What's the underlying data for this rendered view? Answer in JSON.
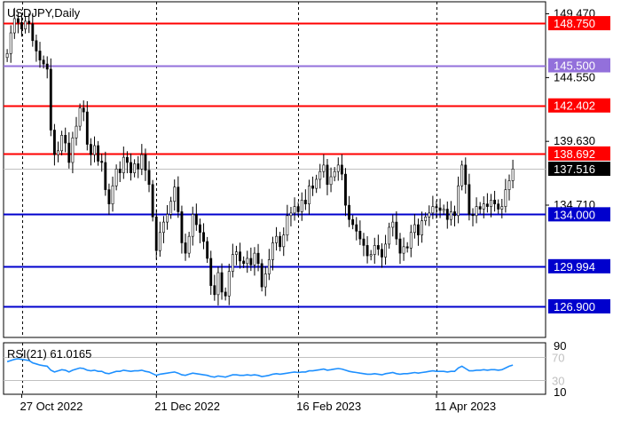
{
  "chart_data": {
    "type": "candlestick",
    "title": "USDJPY,Daily",
    "y_range": [
      124.5,
      150.4
    ],
    "x_index_range": [
      -1,
      148
    ],
    "price_ticks": [
      "149.470",
      "144.550",
      "139.630",
      "134.710"
    ],
    "x_ticks": [
      {
        "label": "27 Oct 2022",
        "index": 4
      },
      {
        "label": "21 Dec 2022",
        "index": 41
      },
      {
        "label": "16 Feb 2023",
        "index": 80
      },
      {
        "label": "11 Apr 2023",
        "index": 118
      }
    ],
    "vertical_grid_index": [
      4,
      41,
      80,
      118
    ],
    "levels": [
      {
        "price": 148.75,
        "label": "148.750",
        "color": "#ff0000",
        "bg": "#ff0000"
      },
      {
        "price": 145.5,
        "label": "145.500",
        "color": "#9370db",
        "bg": "#9370db"
      },
      {
        "price": 142.402,
        "label": "142.402",
        "color": "#ff0000",
        "bg": "#ff0000"
      },
      {
        "price": 138.692,
        "label": "138.692",
        "color": "#ff0000",
        "bg": "#ff0000"
      },
      {
        "price": 134.0,
        "label": "134.000",
        "color": "#0000cd",
        "bg": "#0000cd"
      },
      {
        "price": 129.994,
        "label": "129.994",
        "color": "#0000cd",
        "bg": "#0000cd"
      },
      {
        "price": 126.9,
        "label": "126.900",
        "color": "#0000cd",
        "bg": "#0000cd"
      }
    ],
    "current_price": {
      "price": 137.516,
      "label": "137.516"
    },
    "closes": [
      146.4,
      148.0,
      149.1,
      148.8,
      148.3,
      148.9,
      148.7,
      147.4,
      146.6,
      145.9,
      145.6,
      145.2,
      140.5,
      138.6,
      138.9,
      140.1,
      139.5,
      138.0,
      139.9,
      140.8,
      142.2,
      141.9,
      139.4,
      138.6,
      139.3,
      138.1,
      138.0,
      135.9,
      134.8,
      136.2,
      137.5,
      137.2,
      138.4,
      138.0,
      137.2,
      137.9,
      137.5,
      138.6,
      137.4,
      136.3,
      133.8,
      131.2,
      132.6,
      133.4,
      134.0,
      135.0,
      136.1,
      134.2,
      131.8,
      131.0,
      132.3,
      134.0,
      133.2,
      132.6,
      131.9,
      130.6,
      128.5,
      127.8,
      129.5,
      128.0,
      127.7,
      129.6,
      130.9,
      131.1,
      130.4,
      130.2,
      130.6,
      130.1,
      131.0,
      130.2,
      128.4,
      129.4,
      130.5,
      131.8,
      132.3,
      131.5,
      132.4,
      133.9,
      134.1,
      134.6,
      134.2,
      135.1,
      134.8,
      136.2,
      136.0,
      136.7,
      137.3,
      137.8,
      136.3,
      136.9,
      137.3,
      137.8,
      137.1,
      134.7,
      133.6,
      133.2,
      132.7,
      132.1,
      131.6,
      130.8,
      130.9,
      131.6,
      131.3,
      130.7,
      131.7,
      133.0,
      133.4,
      132.1,
      131.0,
      131.5,
      131.4,
      132.6,
      133.2,
      132.4,
      133.5,
      133.8,
      134.1,
      134.6,
      134.5,
      134.3,
      134.4,
      133.6,
      134.2,
      133.9,
      136.2,
      137.8,
      136.3,
      134.0,
      133.9,
      134.6,
      134.4,
      134.8,
      134.6,
      135.1,
      134.8,
      134.4,
      134.6,
      135.9,
      136.6,
      137.5
    ],
    "rsi": {
      "label": "RSI(21) 61.0165",
      "levels": [
        {
          "value": 70,
          "label": "70"
        },
        {
          "value": 30,
          "label": "30"
        }
      ],
      "axis_labels": [
        {
          "value": 90,
          "label": "90"
        },
        {
          "value": 10,
          "label": "10"
        }
      ],
      "range": [
        5,
        95
      ],
      "color": "#1e90ff",
      "values": [
        62,
        64,
        66,
        67,
        66,
        65,
        64,
        60,
        58,
        56,
        55,
        54,
        47,
        44,
        46,
        48,
        47,
        44,
        47,
        49,
        51,
        50,
        47,
        46,
        47,
        45,
        45,
        42,
        41,
        43,
        45,
        45,
        47,
        46,
        45,
        46,
        46,
        47,
        45,
        44,
        41,
        38,
        40,
        41,
        42,
        43,
        44,
        42,
        39,
        38,
        40,
        42,
        41,
        40,
        39,
        38,
        36,
        35,
        37,
        36,
        35,
        37,
        39,
        39,
        38,
        38,
        39,
        38,
        39,
        38,
        36,
        37,
        38,
        40,
        41,
        40,
        41,
        42,
        43,
        44,
        43,
        44,
        44,
        46,
        46,
        47,
        48,
        49,
        47,
        48,
        49,
        50,
        49,
        47,
        45,
        44,
        43,
        42,
        41,
        40,
        40,
        41,
        40,
        39,
        41,
        42,
        43,
        41,
        40,
        41,
        41,
        42,
        43,
        42,
        43,
        44,
        45,
        46,
        45,
        45,
        45,
        44,
        45,
        45,
        51,
        54,
        50,
        46,
        46,
        47,
        47,
        48,
        47,
        48,
        48,
        47,
        48,
        51,
        54,
        56
      ]
    }
  }
}
